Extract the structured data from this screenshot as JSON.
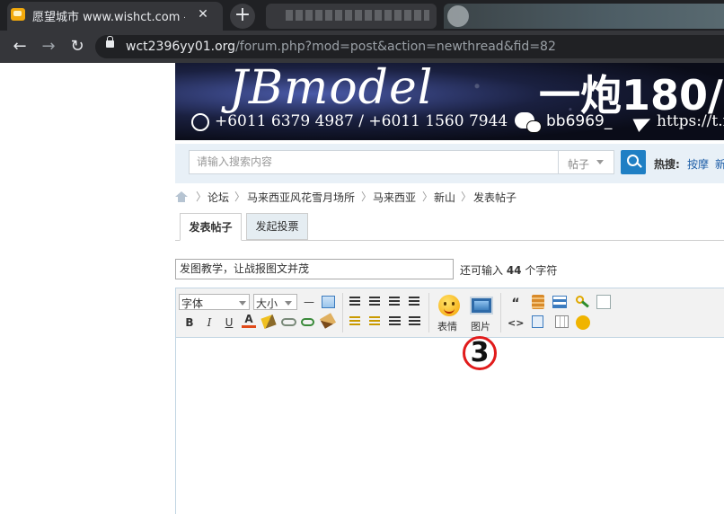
{
  "browser": {
    "active_tab_title": "愿望城市 www.wishct.com - - -",
    "tab_close": "✕",
    "new_tab": "+",
    "url_host": "wct2396yy01.org",
    "url_path": "/forum.php?mod=post&action=newthread&fid=82",
    "back": "←",
    "forward": "→",
    "reload": "↻"
  },
  "banner": {
    "brand": "JBmodel",
    "promo": "一炮180/",
    "phones": "+6011 6379 4987 / +6011 1560 7944",
    "wechat": "bb6969_",
    "telegram": "https://t.m"
  },
  "search": {
    "placeholder": "请输入搜索内容",
    "type_label": "帖子",
    "hot_label": "热搜:",
    "hot_links": [
      "按摩",
      "新"
    ]
  },
  "breadcrumb": [
    "论坛",
    "马来西亚风花雪月场所",
    "马来西亚",
    "新山",
    "发表帖子"
  ],
  "breadcrumb_sep": "〉",
  "tabs": [
    "发表帖子",
    "发起投票"
  ],
  "subject": {
    "value": "发图教学，让战报图文并茂",
    "count_prefix": "还可输入 ",
    "count_value": "44",
    "count_suffix": " 个字符"
  },
  "editor": {
    "font_label": "字体",
    "size_label": "大小",
    "emoji_label": "表情",
    "image_label": "图片",
    "buttons": {
      "hr": "—",
      "bold": "B",
      "italic": "I",
      "underline": "U",
      "fontcolor": "A",
      "quote": "“",
      "code": "<>"
    }
  },
  "annotation": {
    "step": "3",
    "color": "#e11b1b"
  }
}
